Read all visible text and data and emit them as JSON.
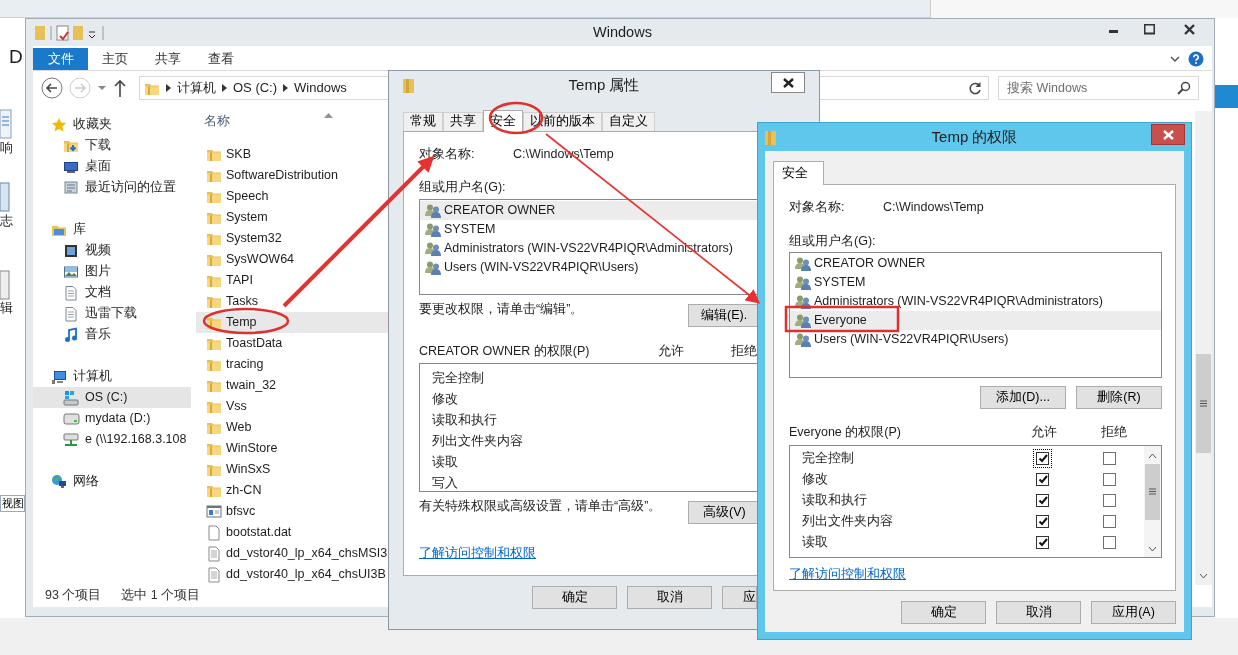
{
  "background": {
    "fragments": [
      "D",
      "响",
      "志",
      "辑"
    ],
    "view_button": "视图"
  },
  "explorer": {
    "title": "Windows",
    "ribbon_tabs": [
      {
        "label": "文件",
        "selected": true
      },
      {
        "label": "主页",
        "selected": false
      },
      {
        "label": "共享",
        "selected": false
      },
      {
        "label": "查看",
        "selected": false
      }
    ],
    "breadcrumb": [
      "计算机",
      "OS (C:)",
      "Windows"
    ],
    "search": {
      "placeholder": "搜索 Windows"
    },
    "nav": [
      {
        "label": "收藏夹",
        "kind": "star",
        "selected": false,
        "children": [
          {
            "label": "下载",
            "kind": "download",
            "selected": false
          },
          {
            "label": "桌面",
            "kind": "desktop",
            "selected": false
          },
          {
            "label": "最近访问的位置",
            "kind": "recent",
            "selected": false
          }
        ]
      },
      {
        "label": "库",
        "kind": "library",
        "selected": false,
        "children": [
          {
            "label": "视频",
            "kind": "video",
            "selected": false
          },
          {
            "label": "图片",
            "kind": "picture",
            "selected": false
          },
          {
            "label": "文档",
            "kind": "document",
            "selected": false
          },
          {
            "label": "迅雷下载",
            "kind": "document",
            "selected": false
          },
          {
            "label": "音乐",
            "kind": "music",
            "selected": false
          }
        ]
      },
      {
        "label": "计算机",
        "kind": "computer",
        "selected": false,
        "children": [
          {
            "label": "OS (C:)",
            "kind": "system-drive",
            "selected": true
          },
          {
            "label": "mydata (D:)",
            "kind": "drive",
            "selected": false
          },
          {
            "label": "e (\\\\192.168.3.108",
            "kind": "network-drive",
            "selected": false
          }
        ]
      },
      {
        "label": "网络",
        "kind": "network",
        "selected": false
      }
    ],
    "column": "名称",
    "files": [
      {
        "name": "SKB",
        "kind": "folder",
        "selected": false
      },
      {
        "name": "SoftwareDistribution",
        "kind": "folder",
        "selected": false
      },
      {
        "name": "Speech",
        "kind": "folder",
        "selected": false
      },
      {
        "name": "System",
        "kind": "folder",
        "selected": false
      },
      {
        "name": "System32",
        "kind": "folder",
        "selected": false
      },
      {
        "name": "SysWOW64",
        "kind": "folder",
        "selected": false
      },
      {
        "name": "TAPI",
        "kind": "folder",
        "selected": false
      },
      {
        "name": "Tasks",
        "kind": "folder",
        "selected": false
      },
      {
        "name": "Temp",
        "kind": "folder",
        "selected": true
      },
      {
        "name": "ToastData",
        "kind": "folder",
        "selected": false
      },
      {
        "name": "tracing",
        "kind": "folder",
        "selected": false
      },
      {
        "name": "twain_32",
        "kind": "folder",
        "selected": false
      },
      {
        "name": "Vss",
        "kind": "folder",
        "selected": false
      },
      {
        "name": "Web",
        "kind": "folder",
        "selected": false
      },
      {
        "name": "WinStore",
        "kind": "folder",
        "selected": false
      },
      {
        "name": "WinSxS",
        "kind": "folder",
        "selected": false
      },
      {
        "name": "zh-CN",
        "kind": "folder",
        "selected": false
      },
      {
        "name": "bfsvc",
        "kind": "app",
        "selected": false
      },
      {
        "name": "bootstat.dat",
        "kind": "file",
        "selected": false
      },
      {
        "name": "dd_vstor40_lp_x64_chsMSI3",
        "kind": "text",
        "selected": false
      },
      {
        "name": "dd_vstor40_lp_x64_chsUI3B",
        "kind": "text",
        "selected": false
      }
    ],
    "status": [
      "93 个项目",
      "选中 1 个项目"
    ]
  },
  "properties": {
    "title": "Temp 属性",
    "tabs": [
      {
        "label": "常规",
        "selected": false
      },
      {
        "label": "共享",
        "selected": false
      },
      {
        "label": "安全",
        "selected": true
      },
      {
        "label": "以前的版本",
        "selected": false
      },
      {
        "label": "自定义",
        "selected": false
      }
    ],
    "object_label": "对象名称:",
    "object_value": "C:\\Windows\\Temp",
    "users_label": "组或用户名(G):",
    "users": [
      {
        "name": "CREATOR OWNER",
        "selected": true
      },
      {
        "name": "SYSTEM",
        "selected": false
      },
      {
        "name": "Administrators (WIN-VS22VR4PIQR\\Administrators)",
        "selected": false
      },
      {
        "name": "Users (WIN-VS22VR4PIQR\\Users)",
        "selected": false
      }
    ],
    "edit_hint": "要更改权限，请单击“编辑”。",
    "edit_button": "编辑(E).",
    "perm_label": "CREATOR OWNER 的权限(P)",
    "allow": "允许",
    "deny": "拒绝",
    "perms": [
      "完全控制",
      "修改",
      "读取和执行",
      "列出文件夹内容",
      "读取",
      "写入"
    ],
    "advanced_hint": "有关特殊权限或高级设置，请单击“高级”。",
    "advanced_button": "高级(V)",
    "link": "了解访问控制和权限",
    "buttons": [
      "确定",
      "取消",
      "应"
    ]
  },
  "permissions": {
    "title": "Temp 的权限",
    "tab": "安全",
    "object_label": "对象名称:",
    "object_value": "C:\\Windows\\Temp",
    "users_label": "组或用户名(G):",
    "users": [
      {
        "name": "CREATOR OWNER",
        "selected": false
      },
      {
        "name": "SYSTEM",
        "selected": false
      },
      {
        "name": "Administrators (WIN-VS22VR4PIQR\\Administrators)",
        "selected": false
      },
      {
        "name": "Everyone",
        "selected": true
      },
      {
        "name": "Users (WIN-VS22VR4PIQR\\Users)",
        "selected": false
      }
    ],
    "add_button": "添加(D)...",
    "remove_button": "删除(R)",
    "perm_label": "Everyone 的权限(P)",
    "allow": "允许",
    "deny": "拒绝",
    "perms": [
      {
        "label": "完全控制",
        "allow": true,
        "deny": false,
        "focused": true
      },
      {
        "label": "修改",
        "allow": true,
        "deny": false,
        "focused": false
      },
      {
        "label": "读取和执行",
        "allow": true,
        "deny": false,
        "focused": false
      },
      {
        "label": "列出文件夹内容",
        "allow": true,
        "deny": false,
        "focused": false
      },
      {
        "label": "读取",
        "allow": true,
        "deny": false,
        "focused": false
      }
    ],
    "link": "了解访问控制和权限",
    "buttons": [
      "确定",
      "取消",
      "应用(A)"
    ]
  }
}
